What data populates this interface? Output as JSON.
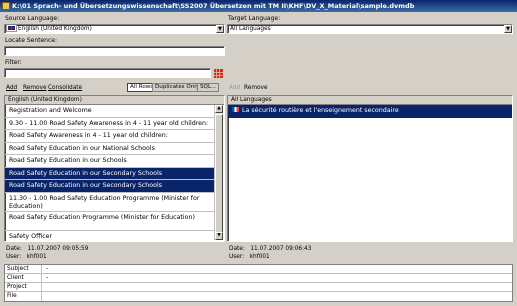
{
  "window": {
    "title": "K:\\01 Sprach- und Übersetzungswissenschaft\\SS2007 Übersetzen mit TM II\\KHF\\DV_X_Material\\sample.dvmdb"
  },
  "source_language": {
    "label": "Source Language:",
    "value": "English (United Kingdom)"
  },
  "target_language": {
    "label": "Target Language:",
    "value": "All Languages"
  },
  "locate": {
    "label": "Locate Sentence:",
    "value": ""
  },
  "filter": {
    "label": "Filter:",
    "value": ""
  },
  "left_toolbar": {
    "add": "Add",
    "remove": "Remove",
    "consolidate": "Consolidate",
    "all_rows": "All Rows",
    "duplicates_only": "Duplicates Only",
    "sql": "SQL..."
  },
  "right_toolbar": {
    "add": "Add",
    "remove": "Remove"
  },
  "source_list": {
    "header": "English (United Kingdom)",
    "rows": [
      "Registration and Welcome",
      "9.30 - 11.00 Road Safety Awareness in 4 - 11 year old children:",
      "Road Safety Awareness in 4 - 11 year old children:",
      "Road Safety Education in our National Schools",
      "Road Safety Education in our Schools",
      "Road Safety Education in our Secondary Schools",
      "Road Safety Education in our Secondary Schools",
      "11.30 - 1.00 Road Safety Education Programme (Minister for Education)",
      "Road Safety Education Programme (Minister for Education)",
      "Safety Officer"
    ]
  },
  "target_list": {
    "header": "All Languages",
    "rows": [
      "La sécurité routière et l'enseignement secondaire"
    ]
  },
  "left_info": {
    "date_label": "Date:",
    "date": "11.07.2007 09:05:59",
    "user_label": "User:",
    "user": "khf001"
  },
  "right_info": {
    "date_label": "Date:",
    "date": "11.07.2007 09:06:43",
    "user_label": "User:",
    "user": "khf001"
  },
  "meta": {
    "rows": [
      {
        "key": "Subject",
        "value": "-"
      },
      {
        "key": "Client",
        "value": "-"
      },
      {
        "key": "Project",
        "value": ""
      },
      {
        "key": "File",
        "value": ""
      }
    ]
  },
  "icons": {
    "title": "folder-icon",
    "filter_options": "grid-icon",
    "source_flag": "uk-flag-icon",
    "target_flag": "french-flag-icon"
  }
}
